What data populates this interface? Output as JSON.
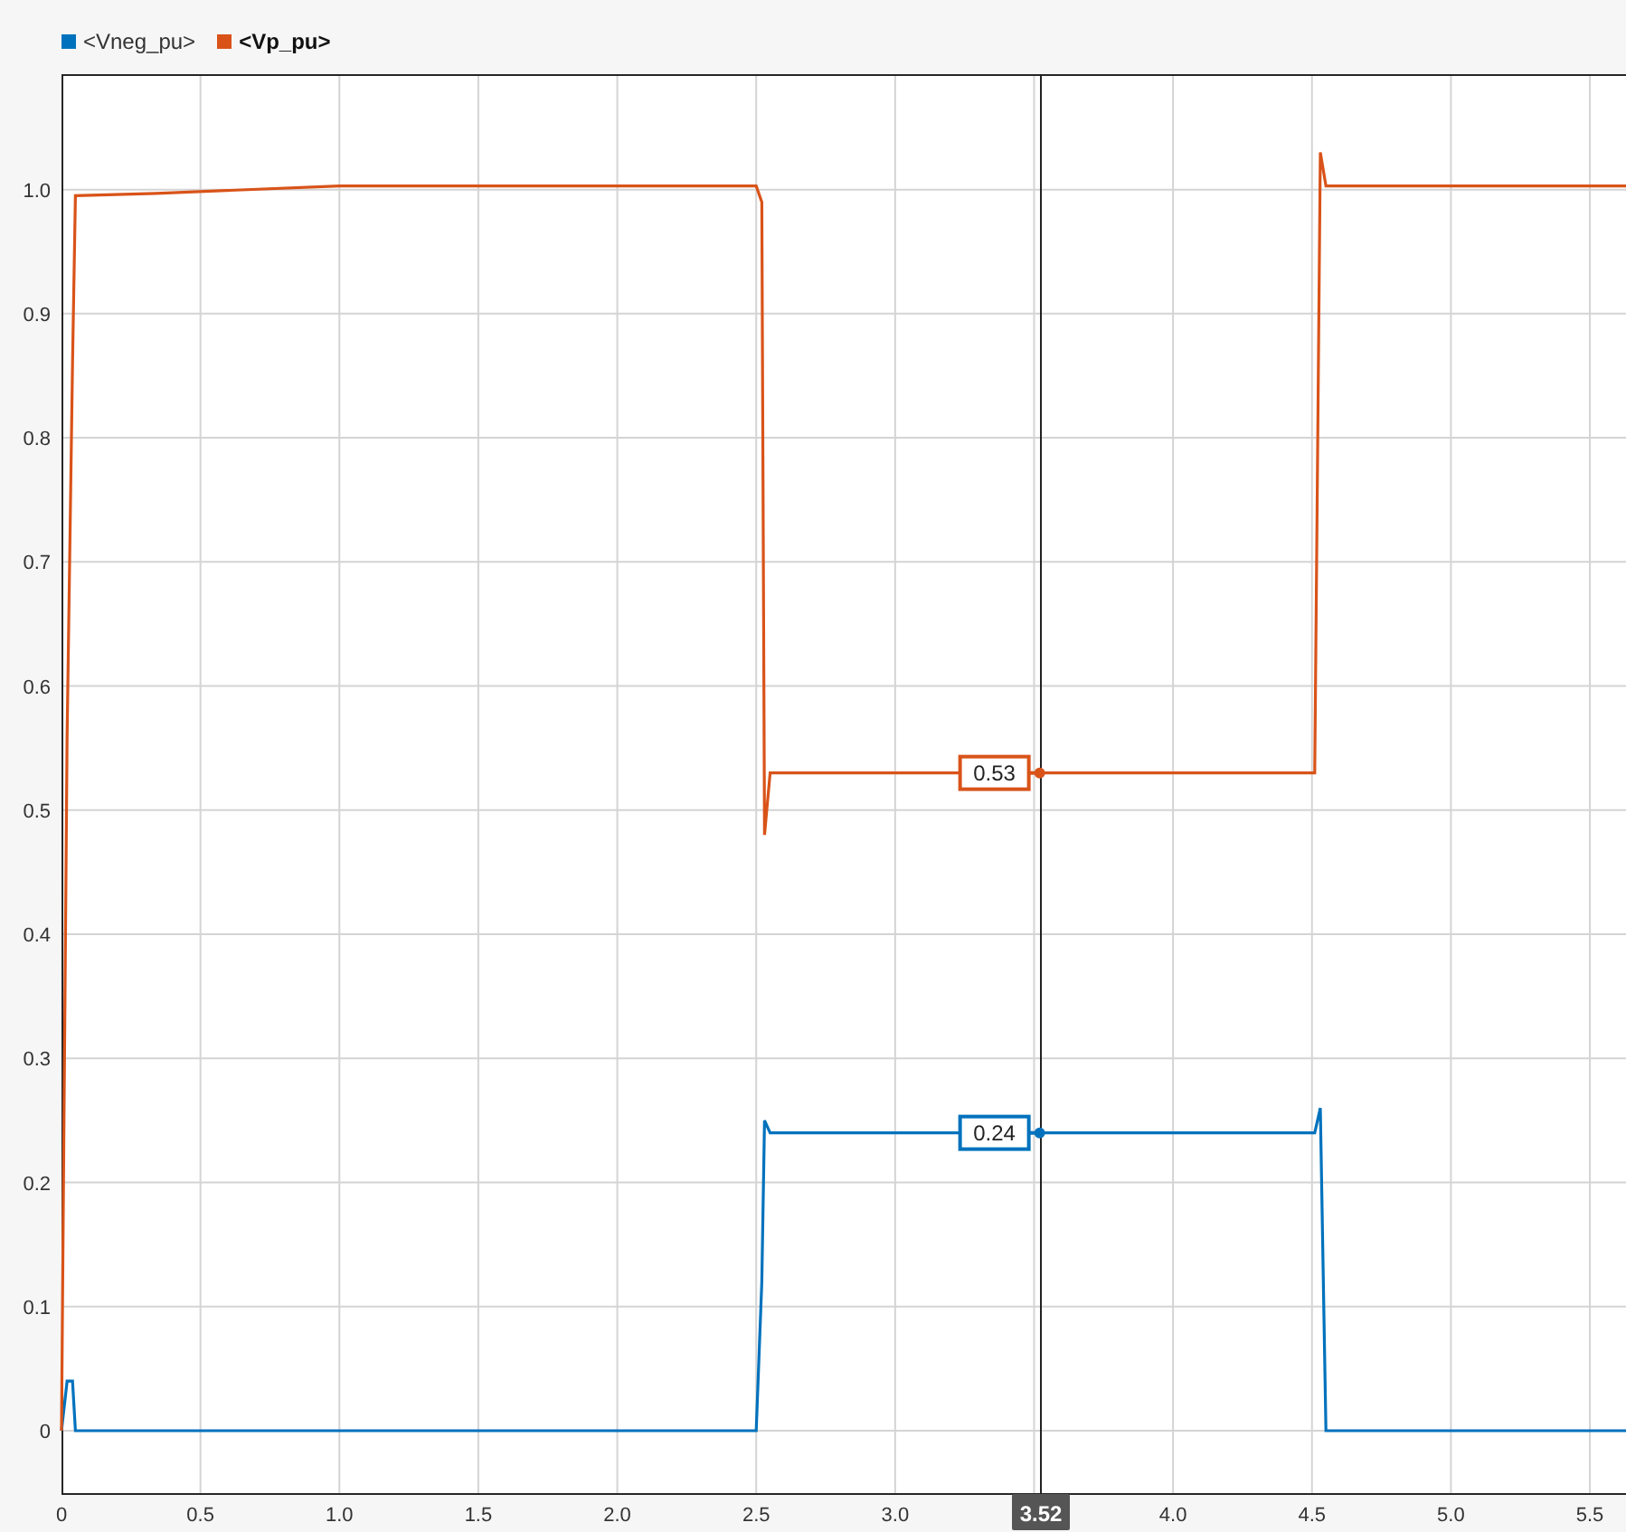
{
  "chart_data": {
    "type": "line",
    "x": [
      0,
      0.02,
      0.04,
      0.05,
      0.34,
      1.0,
      2.5,
      2.52,
      2.53,
      2.55,
      3.52,
      4.51,
      4.53,
      4.55,
      5.63
    ],
    "series": [
      {
        "color": "#0072bd",
        "values": [
          0,
          0.04,
          0.04,
          0,
          0,
          0,
          0,
          0.12,
          0.25,
          0.24,
          0.24,
          0.24,
          0.26,
          0,
          0
        ]
      },
      {
        "color": "#d95319",
        "values": [
          0,
          0.56,
          0.86,
          0.995,
          0.997,
          1.003,
          1.003,
          0.99,
          0.48,
          0.53,
          0.53,
          0.53,
          1.03,
          1.003,
          1.003
        ]
      }
    ],
    "grid": true,
    "xlim": [
      0,
      5.63
    ],
    "ylim": [
      -0.051,
      1.093
    ],
    "xticks": [
      {
        "value": 0,
        "label": "0"
      },
      {
        "value": 0.5,
        "label": "0.5"
      },
      {
        "value": 1,
        "label": "1.0"
      },
      {
        "value": 1.5,
        "label": "1.5"
      },
      {
        "value": 2,
        "label": "2.0"
      },
      {
        "value": 2.5,
        "label": "2.5"
      },
      {
        "value": 3,
        "label": "3.0"
      },
      {
        "value": 4,
        "label": "4.0"
      },
      {
        "value": 4.5,
        "label": "4.5"
      },
      {
        "value": 5,
        "label": "5.0"
      },
      {
        "value": 5.5,
        "label": "5.5"
      }
    ],
    "yticks": [
      {
        "value": 0,
        "label": "0"
      },
      {
        "value": 0.1,
        "label": "0.1"
      },
      {
        "value": 0.2,
        "label": "0.2"
      },
      {
        "value": 0.3,
        "label": "0.3"
      },
      {
        "value": 0.4,
        "label": "0.4"
      },
      {
        "value": 0.5,
        "label": "0.5"
      },
      {
        "value": 0.6,
        "label": "0.6"
      },
      {
        "value": 0.7,
        "label": "0.7"
      },
      {
        "value": 0.8,
        "label": "0.8"
      },
      {
        "value": 0.9,
        "label": "0.9"
      },
      {
        "value": 1,
        "label": "1.0"
      }
    ],
    "ref_lines": [
      {
        "axis": "x",
        "value": 3.52,
        "label": "3.52",
        "color": "#222222"
      }
    ],
    "annotations": [
      {
        "text": "0.53",
        "x": 3.52,
        "y": 0.53
      },
      {
        "text": "0.24",
        "x": 3.52,
        "y": 0.24
      }
    ]
  },
  "legend": [
    {
      "label": "<Vneg_pu>",
      "selected": false
    },
    {
      "label": "<Vp_pu>",
      "selected": true
    }
  ]
}
